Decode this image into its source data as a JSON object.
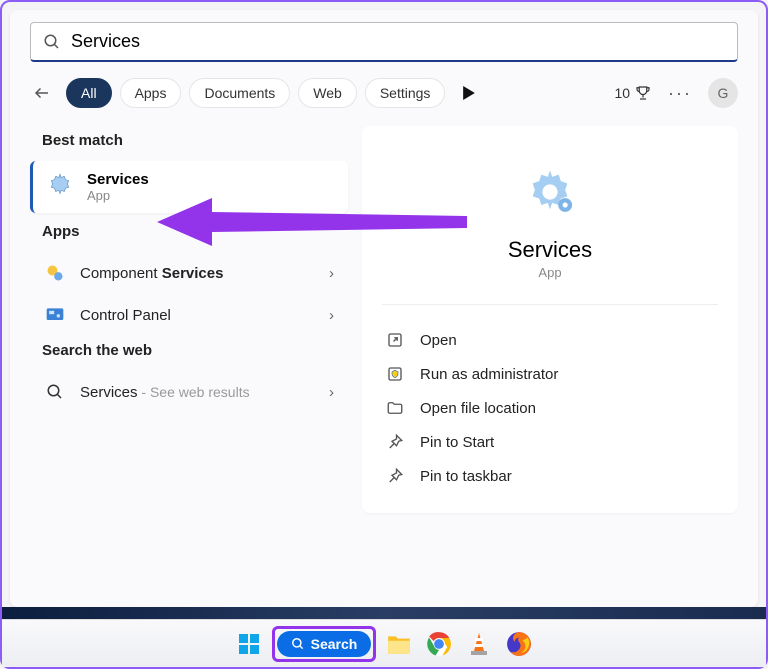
{
  "search": {
    "value": "Services",
    "placeholder": ""
  },
  "back_label": "Back",
  "filters": [
    "All",
    "Apps",
    "Documents",
    "Web",
    "Settings"
  ],
  "filter_active_index": 0,
  "rewards": {
    "count": "10"
  },
  "avatar_letter": "G",
  "sections": {
    "best_match": "Best match",
    "apps": "Apps",
    "web": "Search the web"
  },
  "best_match_result": {
    "title": "Services",
    "subtitle": "App"
  },
  "app_results": [
    {
      "prefix": "Component ",
      "bold": "Services"
    },
    {
      "prefix": "",
      "bold": "",
      "plain": "Control Panel"
    }
  ],
  "web_result": {
    "term": "Services",
    "hint": " - See web results"
  },
  "details": {
    "title": "Services",
    "subtitle": "App",
    "actions": [
      "Open",
      "Run as administrator",
      "Open file location",
      "Pin to Start",
      "Pin to taskbar"
    ]
  },
  "taskbar": {
    "search_label": "Search"
  }
}
